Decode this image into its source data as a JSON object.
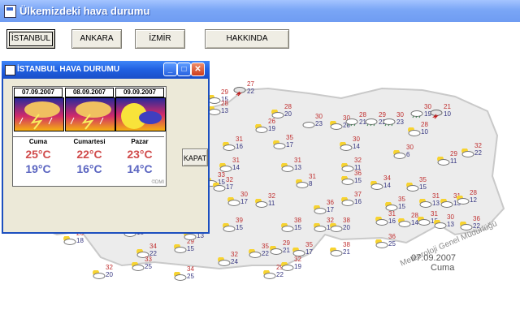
{
  "window": {
    "title": "Ülkemizdeki hava durumu"
  },
  "buttons": [
    {
      "id": "istanbul",
      "label": "İSTANBUL"
    },
    {
      "id": "ankara",
      "label": "ANKARA"
    },
    {
      "id": "izmir",
      "label": "İZMİR"
    },
    {
      "id": "hakkinda",
      "label": "HAKKINDA"
    }
  ],
  "map": {
    "stamp_org": "Meteoroloji Genel Müdürlüğü",
    "stamp_date": "07.09.2007",
    "stamp_day": "Cuma",
    "cities": [
      {
        "hi": "27",
        "lo": "22",
        "type": "storm"
      },
      {
        "hi": "29",
        "lo": "15",
        "type": "partly"
      },
      {
        "hi": "28",
        "lo": "13",
        "type": "partly"
      },
      {
        "hi": "28",
        "lo": "20",
        "type": "partly"
      },
      {
        "hi": "26",
        "lo": "19",
        "type": "partly"
      },
      {
        "hi": "30",
        "lo": "23",
        "type": "cloudy"
      },
      {
        "hi": "30",
        "lo": "20",
        "type": "partly"
      },
      {
        "hi": "28",
        "lo": "21",
        "type": "rain"
      },
      {
        "hi": "29",
        "lo": "22",
        "type": "rain"
      },
      {
        "hi": "30",
        "lo": "23",
        "type": "rain"
      },
      {
        "hi": "30",
        "lo": "19",
        "type": "rain"
      },
      {
        "hi": "21",
        "lo": "10",
        "type": "storm"
      },
      {
        "hi": "28",
        "lo": "10",
        "type": "partly"
      },
      {
        "hi": "31",
        "lo": "16",
        "type": "partly"
      },
      {
        "hi": "35",
        "lo": "17",
        "type": "partly"
      },
      {
        "hi": "30",
        "lo": "14",
        "type": "partly"
      },
      {
        "hi": "30",
        "lo": "6",
        "type": "partly"
      },
      {
        "hi": "29",
        "lo": "11",
        "type": "partly"
      },
      {
        "hi": "32",
        "lo": "22",
        "type": "partly"
      },
      {
        "hi": "31",
        "lo": "14",
        "type": "partly"
      },
      {
        "hi": "31",
        "lo": "13",
        "type": "partly"
      },
      {
        "hi": "32",
        "lo": "11",
        "type": "partly"
      },
      {
        "hi": "33",
        "lo": "15",
        "type": "partly"
      },
      {
        "hi": "31",
        "lo": "8",
        "type": "partly"
      },
      {
        "hi": "36",
        "lo": "15",
        "type": "partly"
      },
      {
        "hi": "34",
        "lo": "14",
        "type": "partly"
      },
      {
        "hi": "35",
        "lo": "15",
        "type": "partly"
      },
      {
        "hi": "32",
        "lo": "17",
        "type": "partly"
      },
      {
        "hi": "30",
        "lo": "17",
        "type": "partly"
      },
      {
        "hi": "32",
        "lo": "11",
        "type": "partly"
      },
      {
        "hi": "31",
        "lo": "13",
        "type": "partly"
      },
      {
        "hi": "36",
        "lo": "17",
        "type": "partly"
      },
      {
        "hi": "37",
        "lo": "16",
        "type": "partly"
      },
      {
        "hi": "35",
        "lo": "15",
        "type": "partly"
      },
      {
        "hi": "31",
        "lo": "13",
        "type": "partly"
      },
      {
        "hi": "28",
        "lo": "12",
        "type": "partly"
      },
      {
        "hi": "32",
        "lo": "19",
        "type": "partly"
      },
      {
        "hi": "31",
        "lo": "16",
        "type": "partly"
      },
      {
        "hi": "28",
        "lo": "14",
        "type": "partly"
      },
      {
        "hi": "31",
        "lo": "15",
        "type": "partly"
      },
      {
        "hi": "30",
        "lo": "13",
        "type": "partly"
      },
      {
        "hi": "36",
        "lo": "22",
        "type": "partly"
      },
      {
        "hi": "38",
        "lo": "20",
        "type": "partly"
      },
      {
        "hi": "39",
        "lo": "15",
        "type": "partly"
      },
      {
        "hi": "38",
        "lo": "15",
        "type": "partly"
      },
      {
        "hi": "38",
        "lo": "20",
        "type": "partly"
      },
      {
        "hi": "34",
        "lo": "18",
        "type": "partly"
      },
      {
        "hi": "31",
        "lo": "18",
        "type": "partly"
      },
      {
        "hi": "29",
        "lo": "14",
        "type": "partly"
      },
      {
        "hi": "26",
        "lo": "18",
        "type": "partly"
      },
      {
        "hi": "34",
        "lo": "22",
        "type": "partly"
      },
      {
        "hi": "29",
        "lo": "15",
        "type": "partly"
      },
      {
        "hi": "35",
        "lo": "22",
        "type": "partly"
      },
      {
        "hi": "29",
        "lo": "21",
        "type": "partly"
      },
      {
        "hi": "35",
        "lo": "17",
        "type": "partly"
      },
      {
        "hi": "38",
        "lo": "21",
        "type": "partly"
      },
      {
        "hi": "36",
        "lo": "25",
        "type": "partly"
      },
      {
        "hi": "32",
        "lo": "20",
        "type": "partly"
      },
      {
        "hi": "33",
        "lo": "25",
        "type": "partly"
      },
      {
        "hi": "34",
        "lo": "25",
        "type": "partly"
      },
      {
        "hi": "32",
        "lo": "24",
        "type": "partly"
      },
      {
        "hi": "29",
        "lo": "22",
        "type": "partly"
      },
      {
        "hi": "32",
        "lo": "19",
        "type": "partly"
      },
      {
        "hi": "16",
        "lo": "19",
        "type": "partly"
      },
      {
        "hi": "15",
        "lo": "16",
        "type": "partly"
      },
      {
        "hi": "14",
        "lo": "15",
        "type": "partly"
      },
      {
        "hi": "15",
        "lo": "15",
        "type": "partly"
      },
      {
        "hi": "15",
        "lo": "13",
        "type": "partly"
      }
    ]
  },
  "dialog": {
    "title": "İSTANBUL HAVA DURUMU",
    "close_button": "KAPAT",
    "copyright": "©DMI",
    "days": [
      {
        "date": "07.09.2007",
        "name": "Cuma",
        "hi": "25°C",
        "lo": "19°C",
        "icon": "storm"
      },
      {
        "date": "08.09.2007",
        "name": "Cumartesi",
        "hi": "22°C",
        "lo": "16°C",
        "icon": "storm"
      },
      {
        "date": "09.09.2007",
        "name": "Pazar",
        "hi": "23°C",
        "lo": "14°C",
        "icon": "moon-cloud"
      }
    ]
  }
}
